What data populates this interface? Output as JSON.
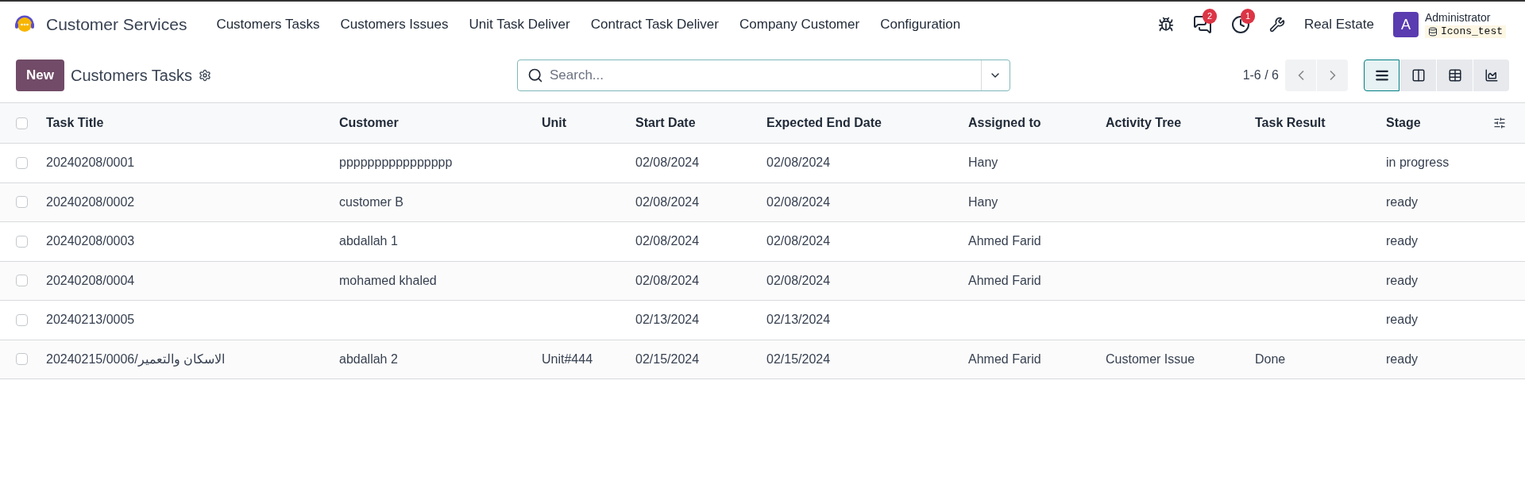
{
  "app": {
    "name": "Customer Services"
  },
  "menu": [
    "Customers Tasks",
    "Customers Issues",
    "Unit Task Deliver",
    "Contract Task Deliver",
    "Company Customer",
    "Configuration"
  ],
  "systray": {
    "messages_count": "2",
    "activities_count": "1",
    "company": "Real Estate",
    "avatar_letter": "A",
    "user": "Administrator",
    "database": "Icons_test"
  },
  "control": {
    "new_button": "New",
    "title": "Customers Tasks",
    "search": {
      "placeholder": "Search..."
    },
    "pager": "1-6 / 6",
    "views": [
      {
        "kind": "list",
        "selected": true
      },
      {
        "kind": "kanban",
        "selected": false
      },
      {
        "kind": "pivot",
        "selected": false
      },
      {
        "kind": "graph",
        "selected": false
      }
    ]
  },
  "table": {
    "select_all": {
      "checked": false
    },
    "columns": [
      "Task Title",
      "Customer",
      "Unit",
      "Start Date",
      "Expected End Date",
      "Assigned to",
      "Activity Tree",
      "Task Result",
      "Stage"
    ],
    "rows": [
      {
        "selected": false,
        "cells": [
          "20240208/0001",
          "pppppppppppppppp",
          "",
          "02/08/2024",
          "02/08/2024",
          "Hany",
          "",
          "",
          "in progress"
        ]
      },
      {
        "selected": false,
        "cells": [
          "20240208/0002",
          "customer B",
          "",
          "02/08/2024",
          "02/08/2024",
          "Hany",
          "",
          "",
          "ready"
        ]
      },
      {
        "selected": false,
        "cells": [
          "20240208/0003",
          "abdallah 1",
          "",
          "02/08/2024",
          "02/08/2024",
          "Ahmed Farid",
          "",
          "",
          "ready"
        ]
      },
      {
        "selected": false,
        "cells": [
          "20240208/0004",
          "mohamed khaled",
          "",
          "02/08/2024",
          "02/08/2024",
          "Ahmed Farid",
          "",
          "",
          "ready"
        ]
      },
      {
        "selected": false,
        "cells": [
          "20240213/0005",
          "",
          "",
          "02/13/2024",
          "02/13/2024",
          "",
          "",
          "",
          "ready"
        ]
      },
      {
        "selected": false,
        "cells": [
          "الاسكان والتعمير/20240215/0006",
          "abdallah 2",
          "Unit#444",
          "02/15/2024",
          "02/15/2024",
          "Ahmed Farid",
          "Customer Issue",
          "Done",
          "ready"
        ]
      }
    ]
  }
}
